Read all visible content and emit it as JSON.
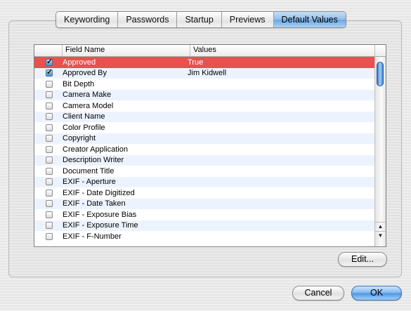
{
  "tabs": [
    {
      "label": "Keywording",
      "selected": false
    },
    {
      "label": "Passwords",
      "selected": false
    },
    {
      "label": "Startup",
      "selected": false
    },
    {
      "label": "Previews",
      "selected": false
    },
    {
      "label": "Default Values",
      "selected": true
    }
  ],
  "table": {
    "columns": {
      "check": "",
      "name": "Field Name",
      "values": "Values"
    },
    "rows": [
      {
        "checked": true,
        "name": "Approved",
        "value": "True",
        "selected": true
      },
      {
        "checked": true,
        "name": "Approved By",
        "value": "Jim Kidwell"
      },
      {
        "checked": false,
        "name": "Bit Depth",
        "value": ""
      },
      {
        "checked": false,
        "name": "Camera Make",
        "value": ""
      },
      {
        "checked": false,
        "name": "Camera Model",
        "value": ""
      },
      {
        "checked": false,
        "name": "Client Name",
        "value": ""
      },
      {
        "checked": false,
        "name": "Color Profile",
        "value": ""
      },
      {
        "checked": false,
        "name": "Copyright",
        "value": ""
      },
      {
        "checked": false,
        "name": "Creator Application",
        "value": ""
      },
      {
        "checked": false,
        "name": "Description Writer",
        "value": ""
      },
      {
        "checked": false,
        "name": "Document Title",
        "value": ""
      },
      {
        "checked": false,
        "name": "EXIF - Aperture",
        "value": ""
      },
      {
        "checked": false,
        "name": "EXIF - Date Digitized",
        "value": ""
      },
      {
        "checked": false,
        "name": "EXIF - Date Taken",
        "value": ""
      },
      {
        "checked": false,
        "name": "EXIF - Exposure Bias",
        "value": ""
      },
      {
        "checked": false,
        "name": "EXIF - Exposure Time",
        "value": ""
      },
      {
        "checked": false,
        "name": "EXIF - F-Number",
        "value": ""
      }
    ]
  },
  "buttons": {
    "edit": "Edit...",
    "cancel": "Cancel",
    "ok": "OK"
  },
  "colors": {
    "selection": "#e5524f",
    "alt_row": "#edf3fe",
    "accent": "#6aa6e0"
  },
  "icons": {
    "scroll_up": "▲",
    "scroll_down": "▼"
  }
}
